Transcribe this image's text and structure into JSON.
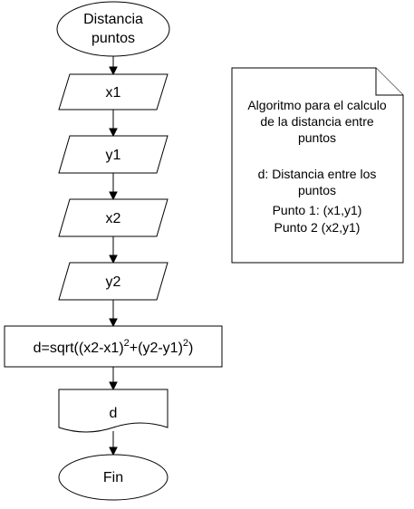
{
  "diagram": {
    "type": "flowchart",
    "nodes": {
      "start": {
        "shape": "terminator",
        "lines": [
          "Distancia",
          "puntos"
        ]
      },
      "input_x1": {
        "shape": "data",
        "label": "x1"
      },
      "input_y1": {
        "shape": "data",
        "label": "y1"
      },
      "input_x2": {
        "shape": "data",
        "label": "x2"
      },
      "input_y2": {
        "shape": "data",
        "label": "y2"
      },
      "process": {
        "shape": "process",
        "parts": [
          "d=sqrt((x2-x1)",
          "2",
          "+(y2-y1)",
          "2",
          ")"
        ]
      },
      "output_d": {
        "shape": "document",
        "label": "d"
      },
      "end": {
        "shape": "terminator",
        "label": "Fin"
      }
    },
    "edges": [
      [
        "start",
        "input_x1"
      ],
      [
        "input_x1",
        "input_y1"
      ],
      [
        "input_y1",
        "input_x2"
      ],
      [
        "input_x2",
        "input_y2"
      ],
      [
        "input_y2",
        "process"
      ],
      [
        "process",
        "output_d"
      ],
      [
        "output_d",
        "end"
      ]
    ],
    "note": {
      "lines": [
        "Algoritmo para el calculo",
        "de la distancia entre",
        "puntos",
        "",
        "d: Distancia entre los",
        "puntos",
        "Punto 1: (x1,y1)",
        "Punto 2 (x2,y1)"
      ]
    }
  }
}
